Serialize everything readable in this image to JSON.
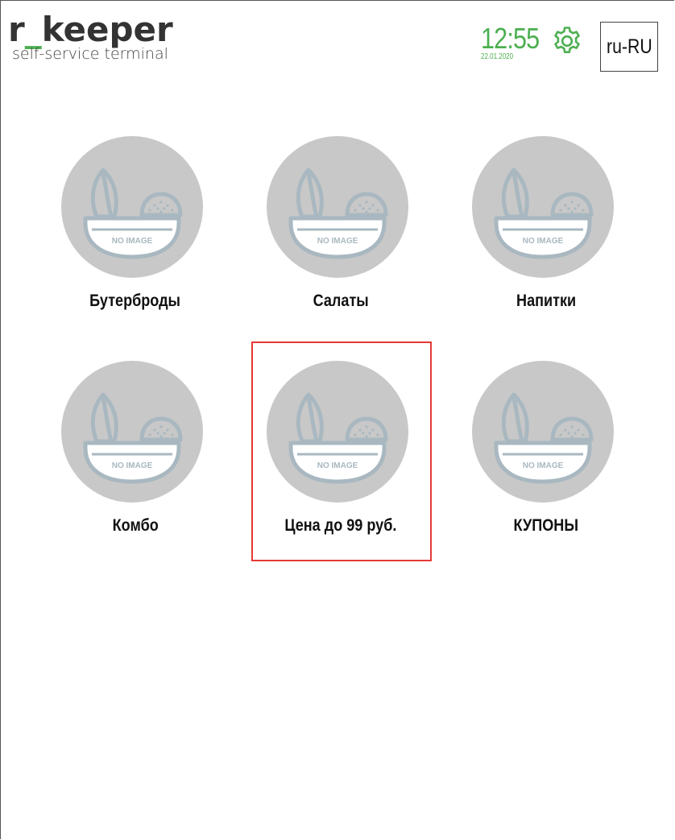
{
  "header": {
    "logo_main_prefix": "r",
    "logo_main_underscore": "_",
    "logo_main_suffix": "keeper",
    "logo_sub": "self-service terminal",
    "time": "12:55",
    "date": "22.01.2020",
    "language": "ru-RU"
  },
  "colors": {
    "accent_green": "#4caf50",
    "placeholder_circle": "#c8c8c8",
    "selection_border": "#e53935"
  },
  "placeholder_text": "NO IMAGE",
  "categories": [
    {
      "label": "Бутерброды",
      "selected": false
    },
    {
      "label": "Салаты",
      "selected": false
    },
    {
      "label": "Напитки",
      "selected": false
    },
    {
      "label": "Комбо",
      "selected": false
    },
    {
      "label": "Цена до 99 руб.",
      "selected": true
    },
    {
      "label": "КУПОНЫ",
      "selected": false
    }
  ]
}
